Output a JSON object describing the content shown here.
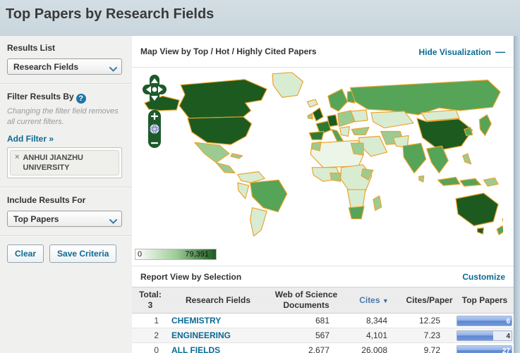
{
  "page": {
    "title": "Top Papers by Research Fields"
  },
  "sidebar": {
    "results_list": {
      "label": "Results List",
      "value": "Research Fields"
    },
    "filter": {
      "label": "Filter Results By",
      "help_icon": "?",
      "note": "Changing the filter field removes all current filters.",
      "add_filter_label": "Add Filter »",
      "active_filters": [
        {
          "remove_symbol": "×",
          "label": "ANHUI JIANZHU UNIVERSITY"
        }
      ]
    },
    "include_results_for": {
      "label": "Include Results For",
      "value": "Top Papers"
    },
    "buttons": {
      "clear": "Clear",
      "save": "Save Criteria"
    }
  },
  "map_panel": {
    "title": "Map View by Top / Hot / Highly Cited Papers",
    "hide_link": "Hide Visualization",
    "hide_icon": "—",
    "legend": {
      "min": "0",
      "max": "79,391"
    },
    "zoom_in": "+",
    "zoom_out": "−"
  },
  "report": {
    "title": "Report View by Selection",
    "customize_link": "Customize",
    "table": {
      "total_label": "Total:",
      "total_value": "3",
      "columns": {
        "field": "Research Fields",
        "documents": "Web of Science Documents",
        "cites": "Cites",
        "sort_icon": "▼",
        "cites_per_paper": "Cites/Paper",
        "top_papers": "Top Papers"
      },
      "rows": [
        {
          "rank": "1",
          "field": "CHEMISTRY",
          "documents": "681",
          "cites": "8,344",
          "cites_per_paper": "12.25",
          "top_papers": "6",
          "bar_fill_pct": 100,
          "bar_value_color": "#ffffff"
        },
        {
          "rank": "2",
          "field": "ENGINEERING",
          "documents": "567",
          "cites": "4,101",
          "cites_per_paper": "7.23",
          "top_papers": "4",
          "bar_fill_pct": 66,
          "bar_value_color": "#333333"
        },
        {
          "rank": "0",
          "field": "ALL FIELDS",
          "documents": "2,677",
          "cites": "26,008",
          "cites_per_paper": "9.72",
          "top_papers": "27",
          "bar_fill_pct": 100,
          "bar_value_color": "#ffffff"
        }
      ]
    }
  },
  "colors": {
    "link_blue": "#0b6a94",
    "header_bg": "#ccd8df",
    "map_dark_green": "#1d5a20",
    "map_medium_green": "#55a457",
    "map_pale_green": "#d8ecd2",
    "map_border_orange": "#eba32c",
    "bar_blue": "#5d87d3"
  }
}
